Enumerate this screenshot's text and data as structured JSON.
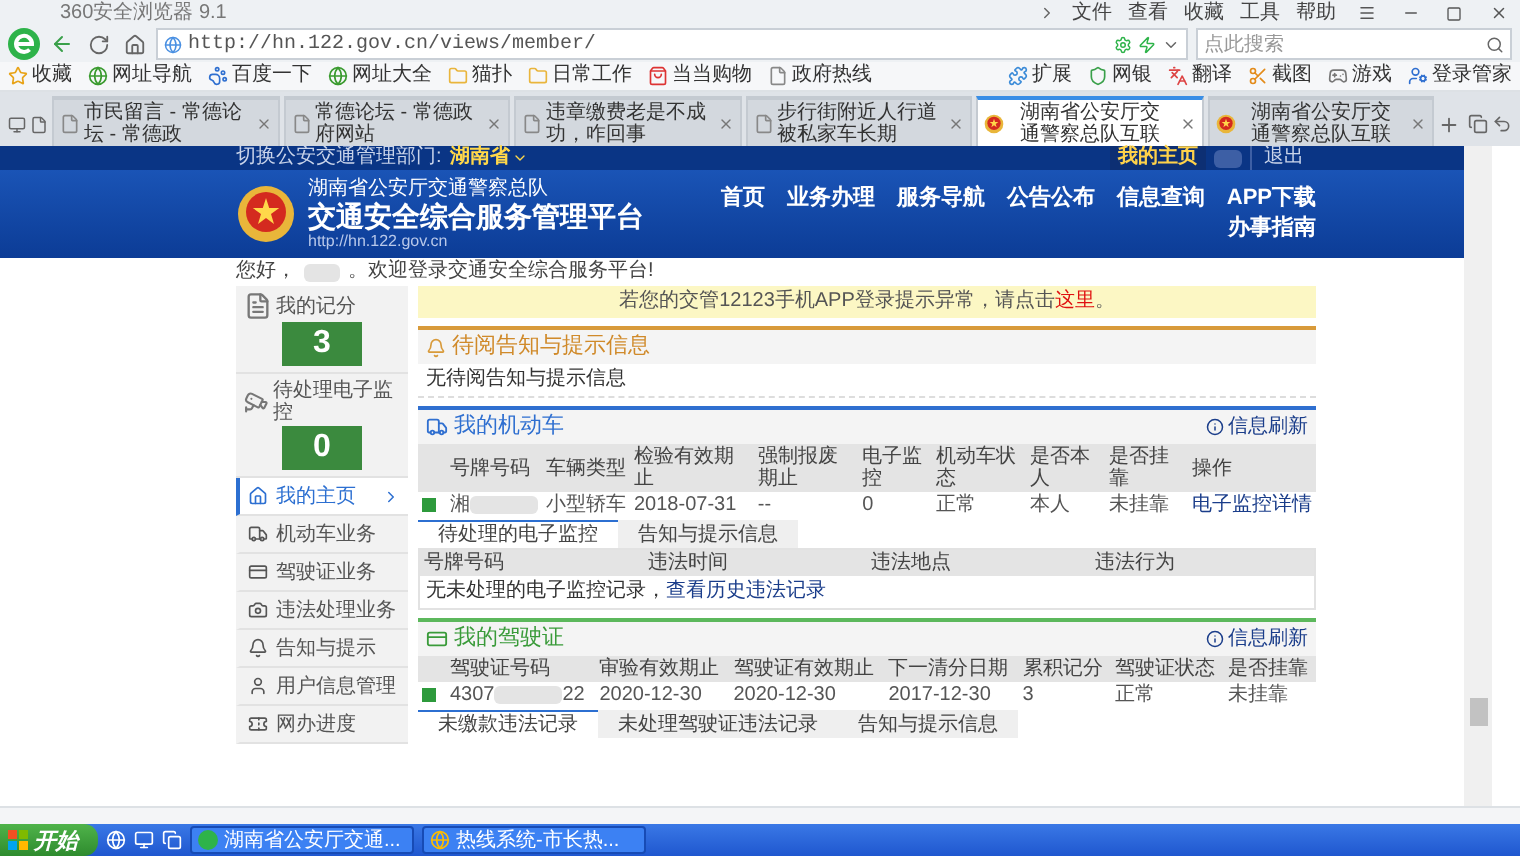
{
  "browser": {
    "title": "360安全浏览器 9.1",
    "menu": [
      "文件",
      "查看",
      "收藏",
      "工具",
      "帮助"
    ],
    "url": "http://hn.122.gov.cn/views/member/",
    "search": {
      "placeholder": "点此搜索"
    },
    "bookmarks_left": [
      {
        "label": "收藏",
        "kind": "favorites"
      },
      {
        "label": "网址导航",
        "kind": "nav"
      },
      {
        "label": "百度一下",
        "kind": "paw"
      },
      {
        "label": "网址大全",
        "kind": "nav"
      },
      {
        "label": "猫扑",
        "kind": "folder"
      },
      {
        "label": "日常工作",
        "kind": "folder"
      },
      {
        "label": "当当购物",
        "kind": "shop"
      },
      {
        "label": "政府热线",
        "kind": "page"
      }
    ],
    "bookmarks_right": [
      {
        "label": "扩展",
        "kind": "extensions"
      },
      {
        "label": "网银",
        "kind": "shield"
      },
      {
        "label": "翻译",
        "kind": "translate"
      },
      {
        "label": "截图",
        "kind": "screenshot"
      },
      {
        "label": "游戏",
        "kind": "game"
      },
      {
        "label": "登录管家",
        "kind": "manager"
      }
    ],
    "tabs": [
      {
        "title": "市民留言 - 常德论坛 - 常德政",
        "kind": "page",
        "selected": false
      },
      {
        "title": "常德论坛 - 常德政府网站",
        "kind": "page",
        "selected": false
      },
      {
        "title": "违章缴费老是不成功，咋回事",
        "kind": "page",
        "selected": false
      },
      {
        "title": "步行街附近人行道被私家车长期",
        "kind": "page",
        "selected": false
      },
      {
        "title": "湖南省公安厅交通警察总队互联",
        "kind": "emblem",
        "selected": true
      },
      {
        "title": "湖南省公安厅交通警察总队互联",
        "kind": "emblem",
        "selected": false
      }
    ]
  },
  "site": {
    "topbar": {
      "switch_label": "切换公安交通管理部门:",
      "region": "湖南省",
      "home": "我的主页",
      "logout": "退出"
    },
    "header": {
      "org": "湖南省公安厅交通警察总队",
      "title": "交通安全综合服务管理平台",
      "url": "http://hn.122.gov.cn",
      "nav": [
        "首页",
        "业务办理",
        "服务导航",
        "公告公布",
        "信息查询",
        "APP下载",
        "办事指南"
      ]
    },
    "greeting": {
      "prefix": "您好，",
      "suffix": "。欢迎登录交通安全综合服务平台!"
    },
    "sidebar": {
      "stats": [
        {
          "label": "我的记分",
          "value": "3",
          "kind": "score"
        },
        {
          "label": "待处理电子监控",
          "value": "0",
          "kind": "camera"
        }
      ],
      "menu": [
        {
          "label": "我的主页",
          "kind": "home",
          "selected": true
        },
        {
          "label": "机动车业务",
          "kind": "vehicle",
          "selected": false
        },
        {
          "label": "驾驶证业务",
          "kind": "license",
          "selected": false
        },
        {
          "label": "违法处理业务",
          "kind": "violation",
          "selected": false
        },
        {
          "label": "告知与提示",
          "kind": "notice",
          "selected": false
        },
        {
          "label": "用户信息管理",
          "kind": "user",
          "selected": false
        },
        {
          "label": "网办进度",
          "kind": "progress",
          "selected": false
        }
      ]
    },
    "notice": {
      "text": "若您的交管12123手机APP登录提示异常，请点击",
      "link": "这里",
      "end": "。"
    },
    "alerts": {
      "title": "待阅告知与提示信息",
      "empty": "无待阅告知与提示信息"
    },
    "vehicles": {
      "title": "我的机动车",
      "refresh": "信息刷新",
      "columns": [
        "号牌号码",
        "车辆类型",
        "检验有效期止",
        "强制报废期止",
        "电子监控",
        "机动车状态",
        "是否本人",
        "是否挂靠",
        "操作"
      ],
      "rows": [
        {
          "cells": [
            {
              "kind": "redacted",
              "prefix": "湘"
            },
            {
              "kind": "text",
              "text": "小型轿车"
            },
            {
              "kind": "text",
              "text": "2018-07-31"
            },
            {
              "kind": "text",
              "text": "--"
            },
            {
              "kind": "text",
              "text": "0"
            },
            {
              "kind": "text",
              "text": "正常"
            },
            {
              "kind": "text",
              "text": "本人"
            },
            {
              "kind": "text",
              "text": "未挂靠"
            },
            {
              "kind": "link",
              "text": "电子监控详情"
            }
          ]
        }
      ],
      "tabs": [
        {
          "label": "待处理的电子监控",
          "selected": true
        },
        {
          "label": "告知与提示信息",
          "selected": false
        }
      ],
      "violation_columns": [
        "号牌号码",
        "违法时间",
        "违法地点",
        "违法行为"
      ],
      "violation_empty": "无未处理的电子监控记录，",
      "history_link": "查看历史违法记录"
    },
    "licenses": {
      "title": "我的驾驶证",
      "refresh": "信息刷新",
      "columns": [
        "驾驶证号码",
        "审验有效期止",
        "驾驶证有效期止",
        "下一清分日期",
        "累积记分",
        "驾驶证状态",
        "是否挂靠"
      ],
      "rows": [
        {
          "cells": [
            {
              "kind": "redacted",
              "prefix": "4307",
              "suffix": "22"
            },
            {
              "kind": "text",
              "text": "2020-12-30"
            },
            {
              "kind": "text",
              "text": "2020-12-30"
            },
            {
              "kind": "text",
              "text": "2017-12-30"
            },
            {
              "kind": "text",
              "text": "3"
            },
            {
              "kind": "text",
              "text": "正常"
            },
            {
              "kind": "text",
              "text": "未挂靠"
            }
          ]
        }
      ],
      "tabs": [
        {
          "label": "未缴款违法记录",
          "selected": true
        },
        {
          "label": "未处理驾驶证违法记录",
          "selected": false
        },
        {
          "label": "告知与提示信息",
          "selected": false
        }
      ]
    }
  },
  "taskbar": {
    "start": "开始",
    "tasks": [
      {
        "label": "湖南省公安厅交通...",
        "kind": "browser"
      },
      {
        "label": "热线系统-市长热...",
        "kind": "chrome"
      }
    ]
  }
}
